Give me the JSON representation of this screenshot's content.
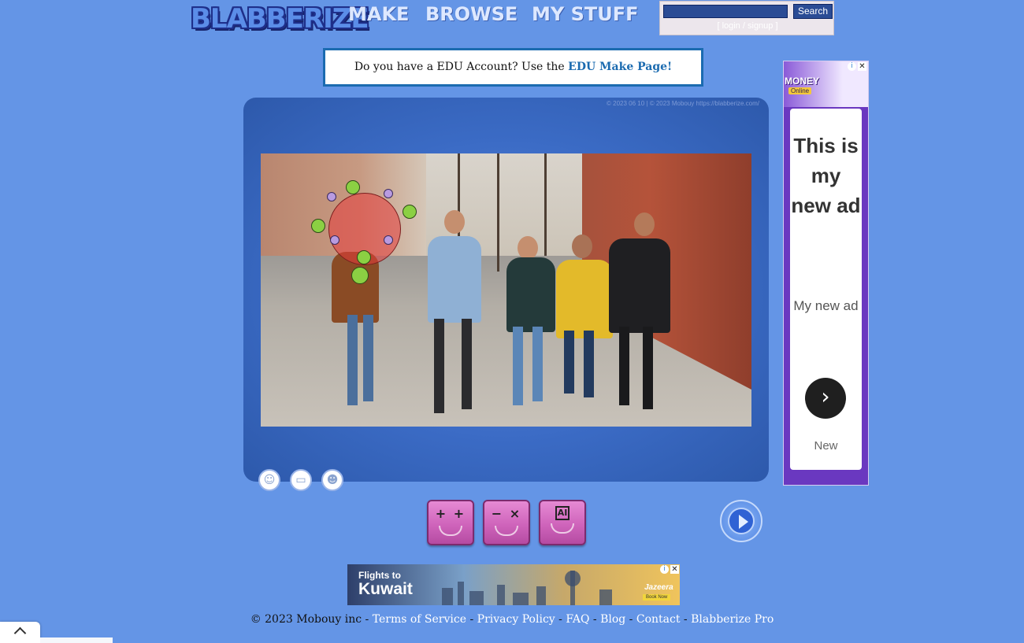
{
  "header": {
    "logo": "BLABBERIZE",
    "nav": {
      "make": "MAKE",
      "browse": "BROWSE",
      "my_stuff": "MY STUFF"
    },
    "search": {
      "button": "Search",
      "value": ""
    },
    "auth": {
      "open": "[",
      "login": "login",
      "sep": " / ",
      "signup": "signup",
      "close": "]"
    }
  },
  "edu_banner": {
    "text": "Do you have a EDU Account? Use the ",
    "link": "EDU Make Page!"
  },
  "editor": {
    "copyright_stamp": "© 2023 06 10  |  © 2023 Mobouy https://blabberize.com/",
    "tools": [
      {
        "name": "face-tool-icon",
        "glyph": "☺"
      },
      {
        "name": "frame-tool-icon",
        "glyph": "▭"
      },
      {
        "name": "mask-tool-icon",
        "glyph": "☻"
      }
    ]
  },
  "actions": {
    "add": {
      "glyph": "+ +",
      "icon": "plus-plus-icon"
    },
    "remove": {
      "glyph": "− ×",
      "icon": "minus-cross-icon"
    },
    "ai": {
      "glyph": "AI",
      "icon": "ai-chip-icon"
    },
    "next": {
      "icon": "play-arrow-icon"
    }
  },
  "side_ad": {
    "money": "MONEY",
    "online": "Online",
    "headline": "This is my new ad",
    "body": "My new ad",
    "arrow": "›",
    "footer": "New",
    "info": "i",
    "close": "✕"
  },
  "bottom_ad": {
    "line1": "Flights to",
    "line2": "Kuwait",
    "brand": "Jazeera",
    "cta": "Book Now",
    "info": "i",
    "close": "✕"
  },
  "footer": {
    "copyright": "© 2023 Mobouy inc - ",
    "links": [
      "Terms of Service",
      "Privacy Policy",
      "FAQ",
      "Blog",
      "Contact",
      "Blabberize Pro"
    ],
    "separator": " - "
  },
  "colors": {
    "page_bg": "#6495e6",
    "panel": "#3b6bc5",
    "link_blue": "#1b6bb0",
    "pink": "#cf64bb"
  }
}
